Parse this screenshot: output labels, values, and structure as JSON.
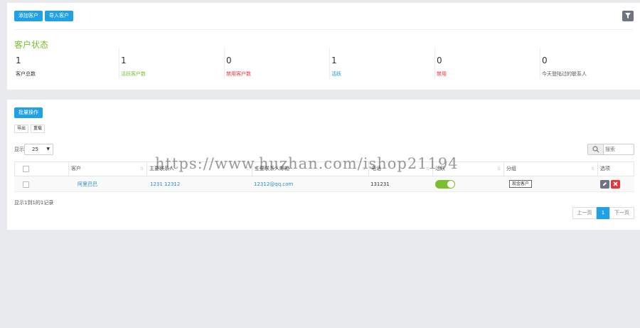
{
  "toolbar": {
    "add_customer": "添加客户",
    "import_customer": "导入客户"
  },
  "status": {
    "title": "客户状态",
    "stats": [
      {
        "value": "1",
        "label": "客户总数",
        "color": "#333333"
      },
      {
        "value": "1",
        "label": "活跃客户数",
        "color": "#7bbe30"
      },
      {
        "value": "0",
        "label": "禁用客户数",
        "color": "#e8343c"
      },
      {
        "value": "1",
        "label": "活跃",
        "color": "#1f8fd1"
      },
      {
        "value": "0",
        "label": "禁用",
        "color": "#e8343c"
      },
      {
        "value": "0",
        "label": "今天登陆过的联系人",
        "color": "#333333"
      }
    ]
  },
  "list": {
    "bulk_action": "批量操作",
    "export": "导出",
    "reload": "重载",
    "show_label": "显示",
    "page_size": "25",
    "search_placeholder": "搜索",
    "columns": [
      "",
      "客户",
      "主要联系人",
      "主要联系人邮箱",
      "电话",
      "活跃",
      "分组",
      "选项"
    ],
    "rows": [
      {
        "customer": "阿里巴巴",
        "contact": "1231 12312",
        "email": "12312@qq.com",
        "phone": "131231",
        "active": true,
        "group": "现金客户"
      }
    ],
    "info": "显示1到1的1记录",
    "pagination": {
      "prev": "上一页",
      "current": "1",
      "next": "下一页"
    }
  },
  "watermark": "https://www.huzhan.com/ishop21194",
  "colors": {
    "accent": "#1fa1e6",
    "success": "#7bbe30",
    "danger": "#e8343c"
  }
}
